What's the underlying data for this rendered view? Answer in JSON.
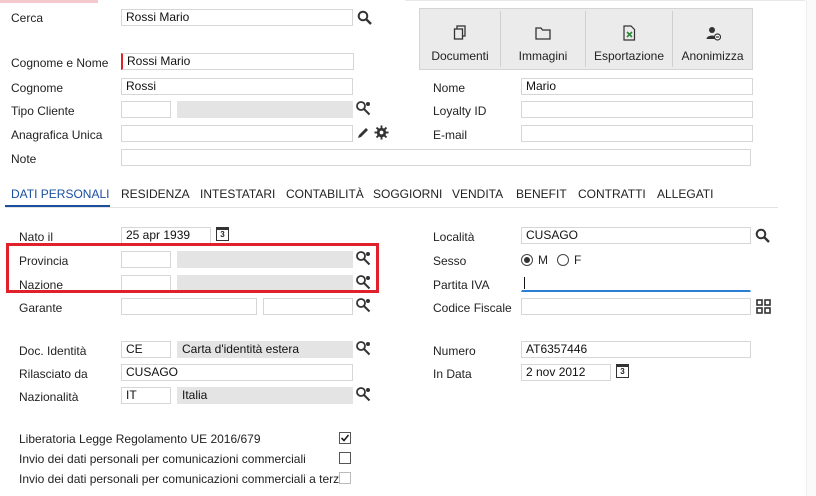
{
  "search": {
    "label": "Cerca",
    "value": "Rossi Mario"
  },
  "toolbar": {
    "documenti": "Documenti",
    "immagini": "Immagini",
    "esportazione": "Esportazione",
    "anonimizza": "Anonimizza"
  },
  "header": {
    "cognome_nome_label": "Cognome e Nome",
    "cognome_nome_value": "Rossi Mario",
    "cognome_label": "Cognome",
    "cognome_value": "Rossi",
    "nome_label": "Nome",
    "nome_value": "Mario",
    "tipo_cliente_label": "Tipo Cliente",
    "tipo_cliente_code": "",
    "tipo_cliente_desc": "",
    "loyalty_label": "Loyalty ID",
    "loyalty_value": "",
    "anagrafica_label": "Anagrafica Unica",
    "anagrafica_value": "",
    "email_label": "E-mail",
    "email_value": "",
    "note_label": "Note",
    "note_value": ""
  },
  "tabs": [
    {
      "label": "DATI PERSONALI",
      "active": true
    },
    {
      "label": "RESIDENZA"
    },
    {
      "label": "INTESTATARI"
    },
    {
      "label": "CONTABILITÀ"
    },
    {
      "label": "SOGGIORNI"
    },
    {
      "label": "VENDITA"
    },
    {
      "label": "BENEFIT"
    },
    {
      "label": "CONTRATTI"
    },
    {
      "label": "ALLEGATI"
    }
  ],
  "personal": {
    "nato_il_label": "Nato il",
    "nato_il_value": "25 apr 1939",
    "provincia_label": "Provincia",
    "provincia_code": "",
    "provincia_desc": "",
    "nazione_label": "Nazione",
    "nazione_code": "",
    "nazione_desc": "",
    "garante_label": "Garante",
    "garante_value": "",
    "garante_desc": "",
    "localita_label": "Località",
    "localita_value": "CUSAGO",
    "sesso_label": "Sesso",
    "sesso_m": "M",
    "sesso_f": "F",
    "sesso_selected": "M",
    "partita_iva_label": "Partita IVA",
    "partita_iva_value": "",
    "codice_fiscale_label": "Codice Fiscale",
    "codice_fiscale_value": "",
    "calendar_day": "3"
  },
  "document": {
    "doc_label": "Doc. Identità",
    "doc_code": "CE",
    "doc_desc": "Carta d'identità estera",
    "rilasciato_label": "Rilasciato da",
    "rilasciato_value": "CUSAGO",
    "nazionalita_label": "Nazionalità",
    "nazionalita_code": "IT",
    "nazionalita_desc": "Italia",
    "numero_label": "Numero",
    "numero_value": "AT6357446",
    "in_data_label": "In Data",
    "in_data_value": "2 nov 2012"
  },
  "consents": [
    {
      "label": "Liberatoria Legge Regolamento UE 2016/679",
      "checked": true
    },
    {
      "label": "Invio dei dati personali per comunicazioni commerciali",
      "checked": false
    },
    {
      "label": "Invio dei dati personali per comunicazioni commerciali a terzi",
      "checked": false
    }
  ],
  "colors": {
    "highlight": "#e0202a",
    "accent": "#1a4fa0",
    "focus": "#2a7fd4"
  }
}
